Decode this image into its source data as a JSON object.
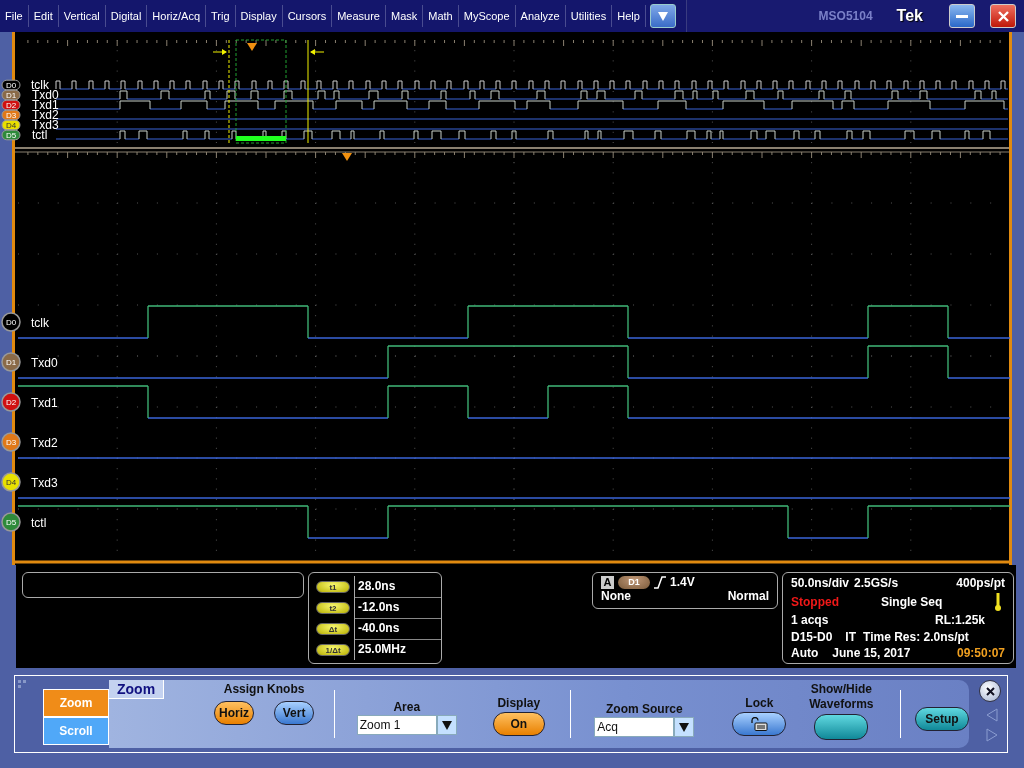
{
  "menu": [
    "File",
    "Edit",
    "Vertical",
    "Digital",
    "Horiz/Acq",
    "Trig",
    "Display",
    "Cursors",
    "Measure",
    "Mask",
    "Math",
    "MyScope",
    "Analyze",
    "Utilities",
    "Help"
  ],
  "title_bar": {
    "model": "MSO5104",
    "logo": "Tek"
  },
  "overview_channels": [
    {
      "badge": "D0",
      "name": "tclk",
      "color": "#000000"
    },
    {
      "badge": "D1",
      "name": "Txd0",
      "color": "#8a6a48"
    },
    {
      "badge": "D2",
      "name": "Txd1",
      "color": "#d01010"
    },
    {
      "badge": "D3",
      "name": "Txd2",
      "color": "#e07818"
    },
    {
      "badge": "D4",
      "name": "Txd3",
      "color": "#e8e000"
    },
    {
      "badge": "D5",
      "name": "tctl",
      "color": "#2e8a3a"
    }
  ],
  "channels": [
    {
      "badge": "D0",
      "name": "tclk",
      "color": "#000000"
    },
    {
      "badge": "D1",
      "name": "Txd0",
      "color": "#8a6a48"
    },
    {
      "badge": "D2",
      "name": "Txd1",
      "color": "#d01010"
    },
    {
      "badge": "D3",
      "name": "Txd2",
      "color": "#e07818"
    },
    {
      "badge": "D4",
      "name": "Txd3",
      "color": "#e8e000"
    },
    {
      "badge": "D5",
      "name": "tctl",
      "color": "#2e8a3a"
    }
  ],
  "cursor_readouts": [
    {
      "label": "t1",
      "value": "28.0ns"
    },
    {
      "label": "t2",
      "value": "-12.0ns"
    },
    {
      "label": "Δt",
      "value": "-40.0ns"
    },
    {
      "label": "1/Δt",
      "value": "25.0MHz"
    }
  ],
  "trigger": {
    "event": "A",
    "source": "D1",
    "level": "1.4V",
    "coupling": "None",
    "mode": "Normal"
  },
  "acquisition": {
    "horizontal_scale": "50.0ns/div",
    "sample_rate": "2.5GS/s",
    "point_spacing": "400ps/pt",
    "run_state": "Stopped",
    "acq_mode": "Single Seq",
    "acq_count": "1 acqs",
    "record_length": "RL:1.25k",
    "digital_channels": "D15-D0",
    "interpolation": "IT",
    "time_resolution": "Time Res: 2.0ns/pt",
    "trigger_mode": "Auto",
    "date": "June 15, 2017",
    "time": "09:50:07"
  },
  "control_panel": {
    "side_tabs": [
      {
        "label": "Zoom",
        "selected": true
      },
      {
        "label": "Scroll",
        "selected": false
      }
    ],
    "title": "Zoom",
    "assign_knobs": {
      "label": "Assign Knobs",
      "buttons": [
        {
          "label": "Horiz",
          "selected": true
        },
        {
          "label": "Vert",
          "selected": false
        }
      ]
    },
    "area": {
      "label": "Area",
      "value": "Zoom 1"
    },
    "display": {
      "label": "Display",
      "button": "On",
      "on": true
    },
    "zoom_source": {
      "label": "Zoom Source",
      "value": "Acq"
    },
    "lock": {
      "label": "Lock"
    },
    "show_hide": {
      "label": "Show/Hide Waveforms"
    },
    "setup": "Setup"
  }
}
